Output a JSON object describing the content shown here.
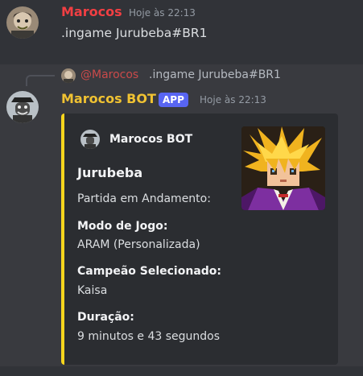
{
  "message1": {
    "author": "Marocos",
    "timestamp": "Hoje às 22:13",
    "content": ".ingame Jurubeba#BR1"
  },
  "message2": {
    "reply": {
      "mention": "@Marocos",
      "text": ".ingame Jurubeba#BR1"
    },
    "author": "Marocos BOT",
    "badge": "APP",
    "timestamp": "Hoje às 22:13",
    "embed": {
      "author": "Marocos BOT",
      "title": "Jurubeba",
      "description": "Partida em Andamento:",
      "accent_color": "#f7d51d",
      "fields": [
        {
          "name": "Modo de Jogo:",
          "value": "ARAM (Personalizada)"
        },
        {
          "name": "Campeão Selecionado:",
          "value": "Kaisa"
        },
        {
          "name": "Duração:",
          "value": "9 minutos e 43 segundos"
        }
      ]
    }
  }
}
